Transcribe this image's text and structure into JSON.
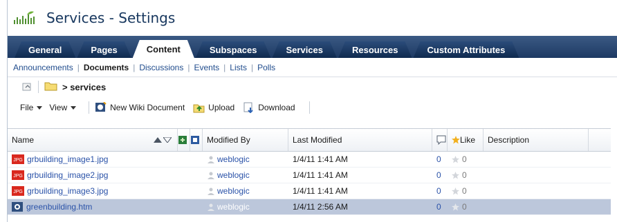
{
  "page": {
    "title": "Services - Settings"
  },
  "tabs": [
    {
      "label": "General"
    },
    {
      "label": "Pages"
    },
    {
      "label": "Content",
      "active": true
    },
    {
      "label": "Subspaces"
    },
    {
      "label": "Services"
    },
    {
      "label": "Resources"
    },
    {
      "label": "Custom Attributes"
    }
  ],
  "subnav": [
    {
      "label": "Announcements"
    },
    {
      "label": "Documents",
      "active": true
    },
    {
      "label": "Discussions"
    },
    {
      "label": "Events"
    },
    {
      "label": "Lists"
    },
    {
      "label": "Polls"
    }
  ],
  "breadcrumb": {
    "path": "> services"
  },
  "toolbar": {
    "file_label": "File",
    "view_label": "View",
    "new_wiki_label": "New Wiki Document",
    "upload_label": "Upload",
    "download_label": "Download"
  },
  "table": {
    "headers": {
      "name": "Name",
      "modified_by": "Modified By",
      "last_modified": "Last Modified",
      "like": "Like",
      "description": "Description"
    },
    "rows": [
      {
        "name": "grbuilding_image1.jpg",
        "modified_by": "weblogic",
        "last_modified": "1/4/11 1:41 AM",
        "comments": "0",
        "likes": "0",
        "icon": "jpg-file-icon"
      },
      {
        "name": "grbuilding_image2.jpg",
        "modified_by": "weblogic",
        "last_modified": "1/4/11 1:41 AM",
        "comments": "0",
        "likes": "0",
        "icon": "jpg-file-icon"
      },
      {
        "name": "grbuilding_image3.jpg",
        "modified_by": "weblogic",
        "last_modified": "1/4/11 1:41 AM",
        "comments": "0",
        "likes": "0",
        "icon": "jpg-file-icon"
      },
      {
        "name": "greenbuilding.htm",
        "modified_by": "weblogic",
        "last_modified": "1/4/11 2:56 AM",
        "comments": "0",
        "likes": "0",
        "icon": "wiki-document-icon",
        "selected": true
      }
    ]
  },
  "colors": {
    "tab_strip": "#1d3a63",
    "selection": "#bcc7db",
    "link": "#2a52a8"
  }
}
